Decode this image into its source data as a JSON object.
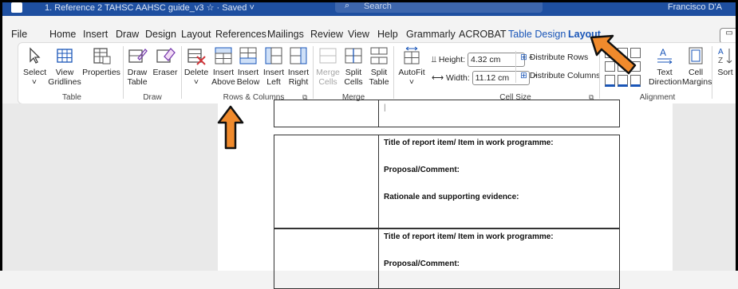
{
  "titlebar": {
    "doc_title": "1. Reference 2 TAHSC AAHSC guide_v3 ☆ · Saved ˅",
    "search_placeholder": "Search",
    "user": "Francisco D'A"
  },
  "tabs": [
    {
      "label": "File"
    },
    {
      "label": "Home"
    },
    {
      "label": "Insert"
    },
    {
      "label": "Draw"
    },
    {
      "label": "Design"
    },
    {
      "label": "Layout"
    },
    {
      "label": "References"
    },
    {
      "label": "Mailings"
    },
    {
      "label": "Review"
    },
    {
      "label": "View"
    },
    {
      "label": "Help"
    },
    {
      "label": "Grammarly"
    },
    {
      "label": "ACROBAT"
    },
    {
      "label": "Table Design"
    },
    {
      "label": "Layout"
    }
  ],
  "ribbon": {
    "table_group": {
      "label": "Table",
      "select": "Select",
      "view_gridlines": [
        "View",
        "Gridlines"
      ],
      "properties": "Properties"
    },
    "draw_group": {
      "label": "Draw",
      "draw_table": [
        "Draw",
        "Table"
      ],
      "eraser": "Eraser"
    },
    "delete": "Delete",
    "rows_cols_group": {
      "label": "Rows & Columns",
      "insert_above": [
        "Insert",
        "Above"
      ],
      "insert_below": [
        "Insert",
        "Below"
      ],
      "insert_left": [
        "Insert",
        "Left"
      ],
      "insert_right": [
        "Insert",
        "Right"
      ]
    },
    "merge_group": {
      "label": "Merge",
      "merge_cells": [
        "Merge",
        "Cells"
      ],
      "split_cells": [
        "Split",
        "Cells"
      ],
      "split_table": [
        "Split",
        "Table"
      ]
    },
    "autofit": "AutoFit",
    "cell_size_group": {
      "label": "Cell Size",
      "height_label": "Height:",
      "height_value": "4.32 cm",
      "width_label": "Width:",
      "width_value": "11.12 cm",
      "distribute_rows": "Distribute Rows",
      "distribute_columns": "Distribute Columns"
    },
    "alignment_group": {
      "label": "Alignment",
      "text_direction": [
        "Text",
        "Direction"
      ],
      "cell_margins": [
        "Cell",
        "Margins"
      ]
    },
    "sort": "Sort"
  },
  "document": {
    "block1": [
      "Title of report item/ Item in work programme:",
      "Proposal/Comment:",
      "Rationale and supporting evidence:"
    ],
    "block2": [
      "Title of report item/ Item in work programme:",
      "Proposal/Comment:"
    ]
  }
}
